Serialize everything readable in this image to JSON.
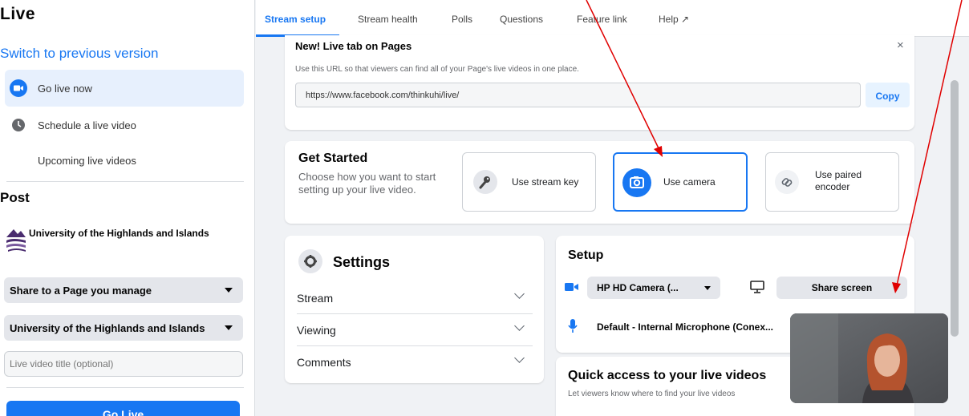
{
  "sidebar": {
    "title": "Live",
    "switch_link": "Switch to previous version",
    "items": [
      {
        "label": "Go live now",
        "icon": "video-camera-icon"
      },
      {
        "label": "Schedule a live video",
        "icon": "clock-icon"
      },
      {
        "label": "Upcoming live videos",
        "icon": ""
      }
    ],
    "post_heading": "Post",
    "org_name": "University of the Highlands and Islands",
    "share_dropdown": "Share to a Page you manage",
    "page_dropdown": "University of the Highlands and Islands",
    "title_placeholder": "Live video title (optional)",
    "go_live_label": "Go Live"
  },
  "tabs": [
    {
      "label": "Stream setup",
      "active": true
    },
    {
      "label": "Stream health"
    },
    {
      "label": "Polls"
    },
    {
      "label": "Questions"
    },
    {
      "label": "Feature link"
    },
    {
      "label": "Help ↗"
    }
  ],
  "new_live_tab": {
    "title": "New! Live tab on Pages",
    "description": "Use this URL so that viewers can find all of your Page's live videos in one place.",
    "url": "https://www.facebook.com/thinkuhi/live/",
    "copy_label": "Copy",
    "close": "×"
  },
  "get_started": {
    "title": "Get Started",
    "description": "Choose how you want to start setting up your live video.",
    "options": [
      {
        "label": "Use stream key",
        "icon": "key-icon"
      },
      {
        "label": "Use camera",
        "icon": "camera-icon",
        "selected": true
      },
      {
        "label": "Use paired encoder",
        "icon": "link-icon"
      }
    ]
  },
  "settings": {
    "title": "Settings",
    "rows": [
      "Stream",
      "Viewing",
      "Comments"
    ]
  },
  "setup": {
    "title": "Setup",
    "camera": "HP HD Camera (...",
    "share_screen": "Share screen",
    "microphone": "Default - Internal Microphone (Conex..."
  },
  "quick_access": {
    "title": "Quick access to your live videos",
    "description": "Let viewers know where to find your live videos"
  },
  "colors": {
    "accent": "#1877f2",
    "annotation": "#e00000"
  }
}
